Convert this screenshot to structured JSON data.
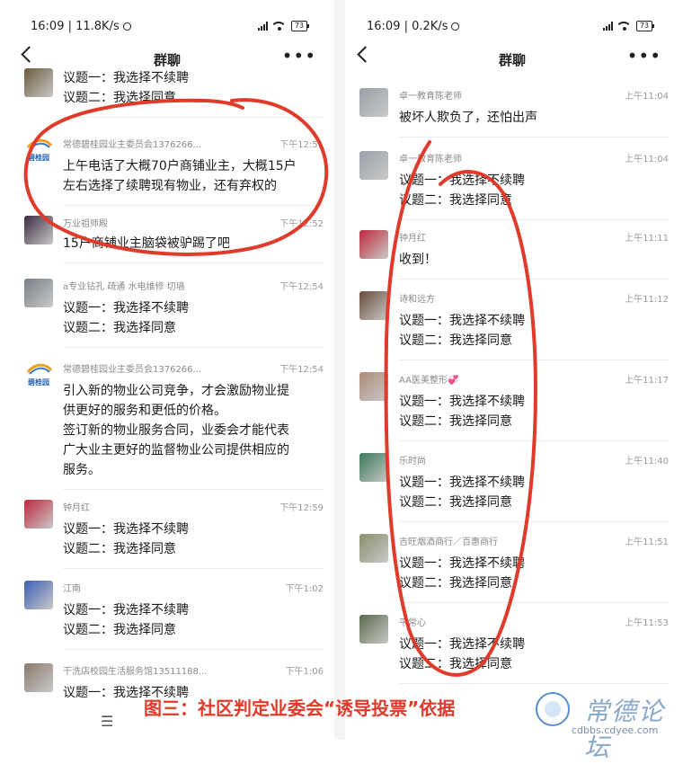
{
  "caption": "图三：社区判定业委会“诱导投票”依据",
  "watermark": {
    "brand": "常德论坛",
    "url": "cdbbs.cdyee.com"
  },
  "left": {
    "status": {
      "time": "16:09 | 11.8K/s",
      "battery": "73"
    },
    "title": "群聊",
    "messages": [
      {
        "name": "",
        "time": "",
        "lines": [
          "议题一：我选择不续聘",
          "议题二：我选择同意"
        ],
        "avatar": "#6b5a3a"
      },
      {
        "name": "常德碧桂园业主委员会1376266...",
        "time": "下午12:51",
        "lines": [
          "上午电话了大概70户商铺业主，大概15户",
          "左右选择了续聘现有物业，还有弃权的"
        ],
        "avatar": "#ffffff"
      },
      {
        "name": "万业祖师殿",
        "time": "下午12:52",
        "lines": [
          "15户商铺业主脑袋被驴踢了吧"
        ],
        "avatar": "#3b2a3f"
      },
      {
        "name": "a专业钻孔  疏通  水电维修  切墙",
        "time": "下午12:54",
        "lines": [
          "议题一：我选择不续聘",
          "议题二：我选择同意"
        ],
        "avatar": "#7a7f86"
      },
      {
        "name": "常德碧桂园业主委员会1376266...",
        "time": "下午12:54",
        "lines": [
          "引入新的物业公司竞争，才会激励物业提",
          "供更好的服务和更低的价格。",
          "签订新的物业服务合同，业委会才能代表",
          "广大业主更好的监督物业公司提供相应的",
          "服务。"
        ],
        "avatar": "#ffffff"
      },
      {
        "name": "钟月红",
        "time": "下午12:59",
        "lines": [
          "议题一：我选择不续聘",
          "议题二：我选择同意"
        ],
        "avatar": "#c0263a"
      },
      {
        "name": "江南",
        "time": "下午1:02",
        "lines": [
          "议题一：我选择不续聘",
          "议题二：我选择同意"
        ],
        "avatar": "#3a5fb5"
      },
      {
        "name": "干洗店校园生活服务馆13511188...",
        "time": "下午1:06",
        "lines": [
          "议题一：我选择不续聘"
        ],
        "avatar": "#8a7a6a"
      }
    ],
    "menu_icon": "menu-icon"
  },
  "right": {
    "status": {
      "time": "16:09 | 0.2K/s",
      "battery": "73"
    },
    "title": "群聊",
    "messages": [
      {
        "name": "卓一教育陈老师",
        "time": "上午11:04",
        "lines": [
          "被坏人欺负了，还怕出声"
        ],
        "avatar": "#9aa0a8"
      },
      {
        "name": "卓一教育陈老师",
        "time": "上午11:04",
        "lines": [
          "议题一：我选择不续聘",
          "议题二：我选择同意"
        ],
        "avatar": "#9aa0a8"
      },
      {
        "name": "钟月红",
        "time": "上午11:11",
        "lines": [
          "收到！"
        ],
        "avatar": "#c0263a"
      },
      {
        "name": "诗和远方",
        "time": "上午11:12",
        "lines": [
          "议题一：我选择不续聘",
          "议题二：我选择同意"
        ],
        "avatar": "#6a4a3a"
      },
      {
        "name": "AA医美整形💞",
        "time": "上午11:17",
        "lines": [
          "议题一：我选择不续聘",
          "议题二：我选择同意"
        ],
        "avatar": "#b08a7a"
      },
      {
        "name": "乐时尚",
        "time": "上午11:40",
        "lines": [
          "议题一：我选择不续聘",
          "议题二：我选择同意"
        ],
        "avatar": "#3a7a5a"
      },
      {
        "name": "吉旺烟酒商行／百惠商行",
        "time": "上午11:51",
        "lines": [
          "议题一：我选择不续聘",
          "议题二：我选择同意"
        ],
        "avatar": "#8a8f6a"
      },
      {
        "name": "平常心",
        "time": "上午11:53",
        "lines": [
          "议题一：我选择不续聘",
          "议题二：我选择同意"
        ],
        "avatar": "#5a6a4a"
      }
    ]
  },
  "logo_text": "碧桂园",
  "colors": {
    "annotation": "#e03a2a"
  }
}
